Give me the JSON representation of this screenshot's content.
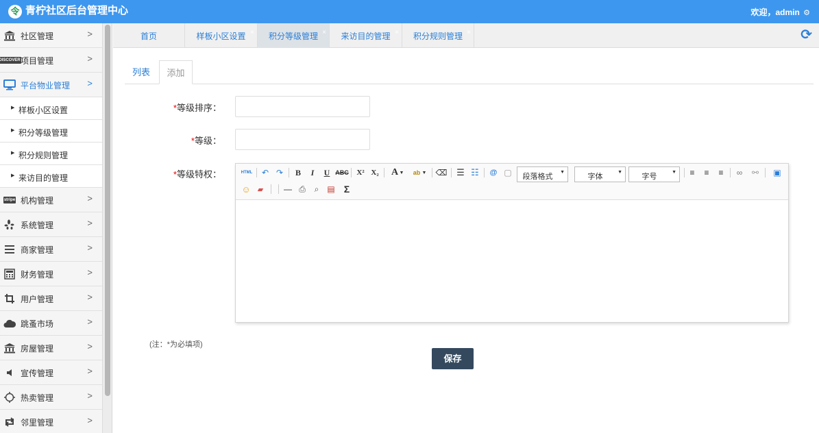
{
  "header": {
    "logo_glyph": "令",
    "title": "青柠社区后台管理中心",
    "welcome": "欢迎，admin",
    "settings_icon": "gear-icon"
  },
  "sidebar": {
    "items": [
      {
        "label": "社区管理",
        "icon": "bank-icon"
      },
      {
        "label": "项目管理",
        "icon": "discover-card-icon"
      },
      {
        "label": "平台物业管理",
        "icon": "desktop-icon",
        "active": true,
        "children": [
          "样板小区设置",
          "积分等级管理",
          "积分规则管理",
          "来访目的管理"
        ]
      },
      {
        "label": "机构管理",
        "icon": "stripe-icon"
      },
      {
        "label": "系统管理",
        "icon": "yelp-icon"
      },
      {
        "label": "商家管理",
        "icon": "bars-icon"
      },
      {
        "label": "财务管理",
        "icon": "calculator-icon"
      },
      {
        "label": "用户管理",
        "icon": "crop-icon"
      },
      {
        "label": "跳蚤市场",
        "icon": "cloud-icon"
      },
      {
        "label": "房屋管理",
        "icon": "bank-icon"
      },
      {
        "label": "宣传管理",
        "icon": "volume-icon"
      },
      {
        "label": "热卖管理",
        "icon": "sun-icon"
      },
      {
        "label": "邻里管理",
        "icon": "retweet-icon"
      }
    ],
    "chevron": ">"
  },
  "tabs": [
    {
      "label": "首页",
      "closable": false
    },
    {
      "label": "样板小区设置",
      "closable": true
    },
    {
      "label": "积分等级管理",
      "closable": true,
      "active": true
    },
    {
      "label": "来访目的管理",
      "closable": true
    },
    {
      "label": "积分规则管理",
      "closable": true
    }
  ],
  "tab_close_glyph": "×",
  "refresh_icon": "refresh-icon",
  "form_tabs": {
    "list": "列表",
    "add": "添加"
  },
  "form": {
    "required_mark": "*",
    "sort_label": "等级排序：",
    "level_label": "等级：",
    "privilege_label": "等级特权："
  },
  "editor": {
    "html_label": "HTML",
    "paragraph_format": "段落格式",
    "font_family": "字体",
    "font_size": "字号"
  },
  "note": "(注：*为必填项)",
  "save_button": "保存",
  "colors": {
    "header_bg": "#3e97ee",
    "accent": "#2b7fd6",
    "save_button_bg": "#34495e",
    "required": "#ee0000"
  }
}
